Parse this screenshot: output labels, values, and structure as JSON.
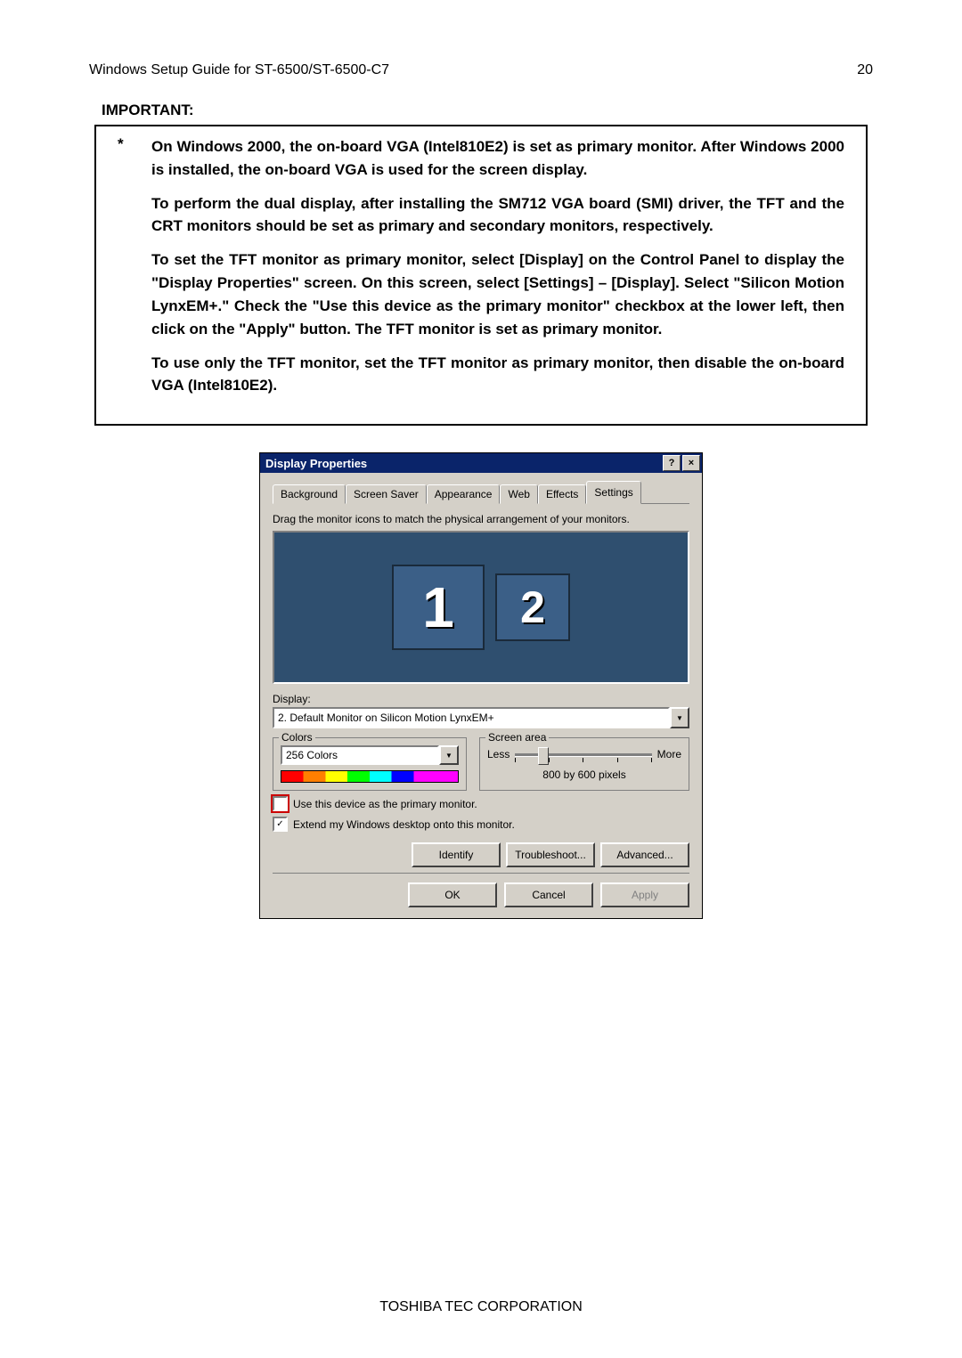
{
  "header": {
    "left": "Windows Setup Guide for ST-6500/ST-6500-C7",
    "right": "20"
  },
  "important_label": "IMPORTANT:",
  "paragraphs": {
    "p1": "On Windows 2000, the on-board VGA (Intel810E2) is set as  primary monitor.  After Windows 2000 is installed, the on-board VGA is used for the screen display.",
    "p2": "To perform the dual  display, after installing the SM712 VGA board (SMI) driver, the TFT and the CRT monitors should be set as primary and secondary monitors, respectively.",
    "p3": "To set the TFT monitor as primary monitor, select [Display] on the Control Panel to display the \"Display Properties\" screen.  On this screen, select [Settings] – [Display].  Select \"Silicon Motion LynxEM+.\"  Check the \"Use this device as  the primary monitor\" checkbox at the lower left, then click on the \"Apply\" button.  The TFT monitor is set as primary monitor.",
    "p4": "To use only the TFT monitor, set the TFT monitor as primary monitor, then disable the on-board VGA (Intel810E2)."
  },
  "dialog": {
    "title": "Display Properties",
    "help": "?",
    "close": "×",
    "tabs": [
      "Background",
      "Screen Saver",
      "Appearance",
      "Web",
      "Effects",
      "Settings"
    ],
    "active_tab": 5,
    "instruction": "Drag the monitor icons to match the physical arrangement of your monitors.",
    "monitors": {
      "m1": "1",
      "m2": "2"
    },
    "display_label": "Display:",
    "display_value": "2. Default Monitor on Silicon Motion LynxEM+",
    "colors_legend": "Colors",
    "colors_value": "256 Colors",
    "screen_legend": "Screen area",
    "slider": {
      "less": "Less",
      "more": "More",
      "value": "800 by 600 pixels"
    },
    "chk1": "Use this device as the primary monitor.",
    "chk2": "Extend my Windows desktop onto this monitor.",
    "chk2_checked": "✓",
    "btn_identify": "Identify",
    "btn_trouble": "Troubleshoot...",
    "btn_adv": "Advanced...",
    "btn_ok": "OK",
    "btn_cancel": "Cancel",
    "btn_apply": "Apply"
  },
  "footer": "TOSHIBA TEC CORPORATION"
}
